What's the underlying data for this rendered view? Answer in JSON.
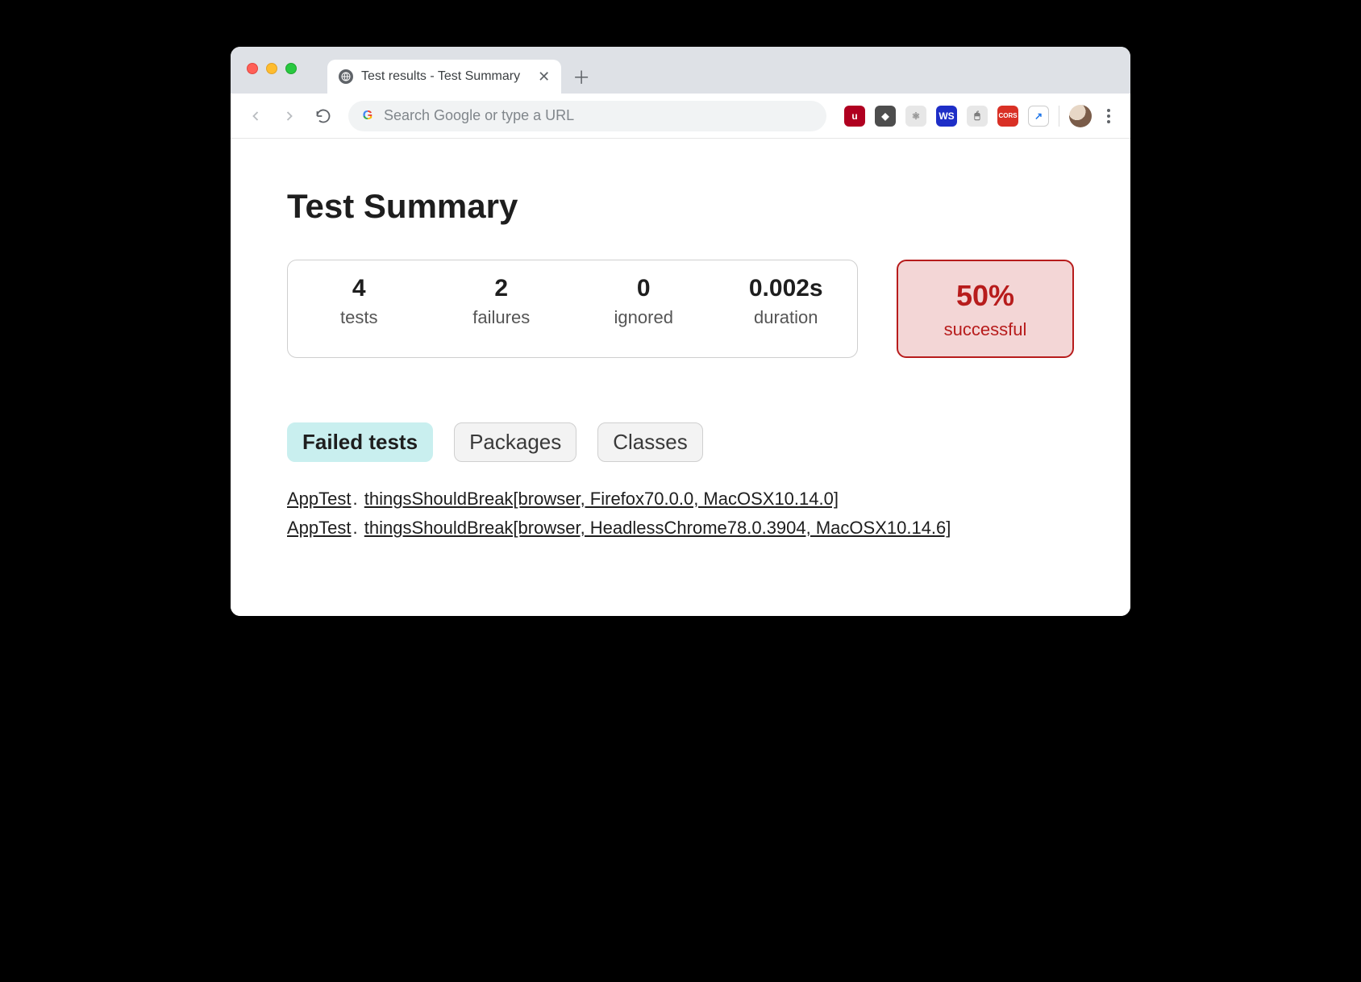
{
  "browser": {
    "tab_title": "Test results - Test Summary",
    "omnibox_placeholder": "Search Google or type a URL",
    "extensions": [
      {
        "name": "ublock-icon",
        "bg": "#b00020",
        "glyph": "u"
      },
      {
        "name": "cube-icon",
        "bg": "#4d4d4d",
        "glyph": "◆"
      },
      {
        "name": "react-devtools-icon",
        "bg": "#e7e7e7",
        "glyph": "⚛",
        "fg": "#8a8a8a"
      },
      {
        "name": "webstorm-icon",
        "bg": "#1e2ec7",
        "glyph": "WS"
      },
      {
        "name": "mouse-icon",
        "bg": "#e7e7e7",
        "glyph": "🖱",
        "fg": "#6b6b6b"
      },
      {
        "name": "cors-icon",
        "bg": "#d93025",
        "glyph": "CORS"
      },
      {
        "name": "optimize-icon",
        "bg": "#ffffff",
        "glyph": "↗",
        "fg": "#1a73e8",
        "border": "1px solid #ccc"
      }
    ]
  },
  "page": {
    "title": "Test Summary",
    "counters": [
      {
        "value": "4",
        "label": "tests"
      },
      {
        "value": "2",
        "label": "failures"
      },
      {
        "value": "0",
        "label": "ignored"
      },
      {
        "value": "0.002s",
        "label": "duration"
      }
    ],
    "success": {
      "percent": "50%",
      "label": "successful"
    },
    "tabs": [
      {
        "label": "Failed tests",
        "active": true
      },
      {
        "label": "Packages",
        "active": false
      },
      {
        "label": "Classes",
        "active": false
      }
    ],
    "failed": [
      {
        "class": "AppTest",
        "method": "thingsShouldBreak[browser, Firefox70.0.0, MacOSX10.14.0]"
      },
      {
        "class": "AppTest",
        "method": "thingsShouldBreak[browser, HeadlessChrome78.0.3904, MacOSX10.14.6]"
      }
    ]
  }
}
